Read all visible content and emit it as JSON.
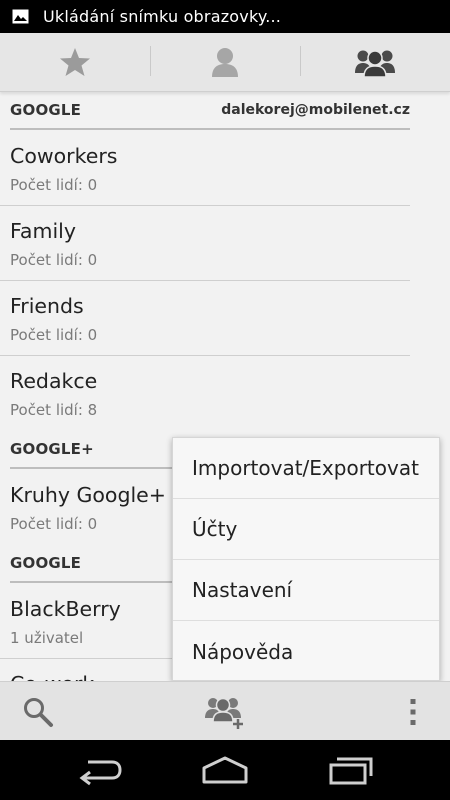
{
  "status_bar": {
    "notification_text": "Ukládání snímku obrazovky..."
  },
  "tabs": [
    {
      "icon": "star-icon",
      "selected": false
    },
    {
      "icon": "person-icon",
      "selected": false
    },
    {
      "icon": "groups-icon",
      "selected": true
    }
  ],
  "sections": [
    {
      "title": "GOOGLE",
      "account": "dalekorej@mobilenet.cz",
      "groups": [
        {
          "name": "Coworkers",
          "count": "Počet lidí: 0"
        },
        {
          "name": "Family",
          "count": "Počet lidí: 0"
        },
        {
          "name": "Friends",
          "count": "Počet lidí: 0"
        },
        {
          "name": "Redakce",
          "count": "Počet lidí: 8"
        }
      ]
    },
    {
      "title": "GOOGLE+",
      "groups": [
        {
          "name": "Kruhy Google+",
          "count": "Počet lidí: 0"
        }
      ]
    },
    {
      "title": "GOOGLE",
      "groups": [
        {
          "name": "BlackBerry",
          "count": "1 uživatel"
        },
        {
          "name": "Co-work",
          "count": ""
        }
      ]
    }
  ],
  "overflow_menu": {
    "items": [
      "Importovat/Exportovat",
      "Účty",
      "Nastavení",
      "Nápověda"
    ]
  },
  "action_bar": {
    "buttons": [
      "search-icon",
      "add-group-icon",
      "overflow-menu-icon"
    ]
  },
  "nav_bar": {
    "buttons": [
      "back-icon",
      "home-icon",
      "recent-apps-icon"
    ]
  }
}
